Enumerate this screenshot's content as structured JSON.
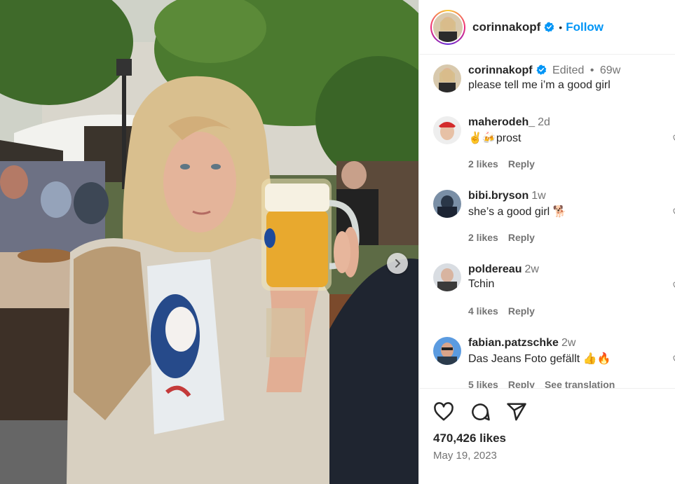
{
  "post": {
    "author": "corinnakopf",
    "follow_label": "Follow",
    "dot": "•",
    "caption": {
      "username": "corinnakopf",
      "edited": "Edited",
      "separator": "•",
      "age": "69w",
      "text": "please tell me i’m a good girl"
    },
    "comments": [
      {
        "username": "maherodeh_",
        "age": "2d",
        "text": "✌️🍻prost",
        "likes": "2 likes",
        "reply": "Reply"
      },
      {
        "username": "bibi.bryson",
        "age": "1w",
        "text": "she’s a good girl 🐕",
        "likes": "2 likes",
        "reply": "Reply"
      },
      {
        "username": "poldereau",
        "age": "2w",
        "text": "Tchin",
        "likes": "4 likes",
        "reply": "Reply"
      },
      {
        "username": "fabian.patzschke",
        "age": "2w",
        "text": "Das Jeans Foto gefällt 👍🔥",
        "likes": "5 likes",
        "reply": "Reply",
        "translate": "See translation"
      }
    ],
    "like_count": "470,426 likes",
    "date": "May 19, 2023"
  },
  "colors": {
    "accent": "#0095f6",
    "verified": "#0095f6",
    "muted": "#737373",
    "text": "#262626"
  },
  "icons": [
    "verified-badge-icon",
    "heart-icon",
    "comment-icon",
    "share-icon",
    "chevron-right-icon"
  ]
}
